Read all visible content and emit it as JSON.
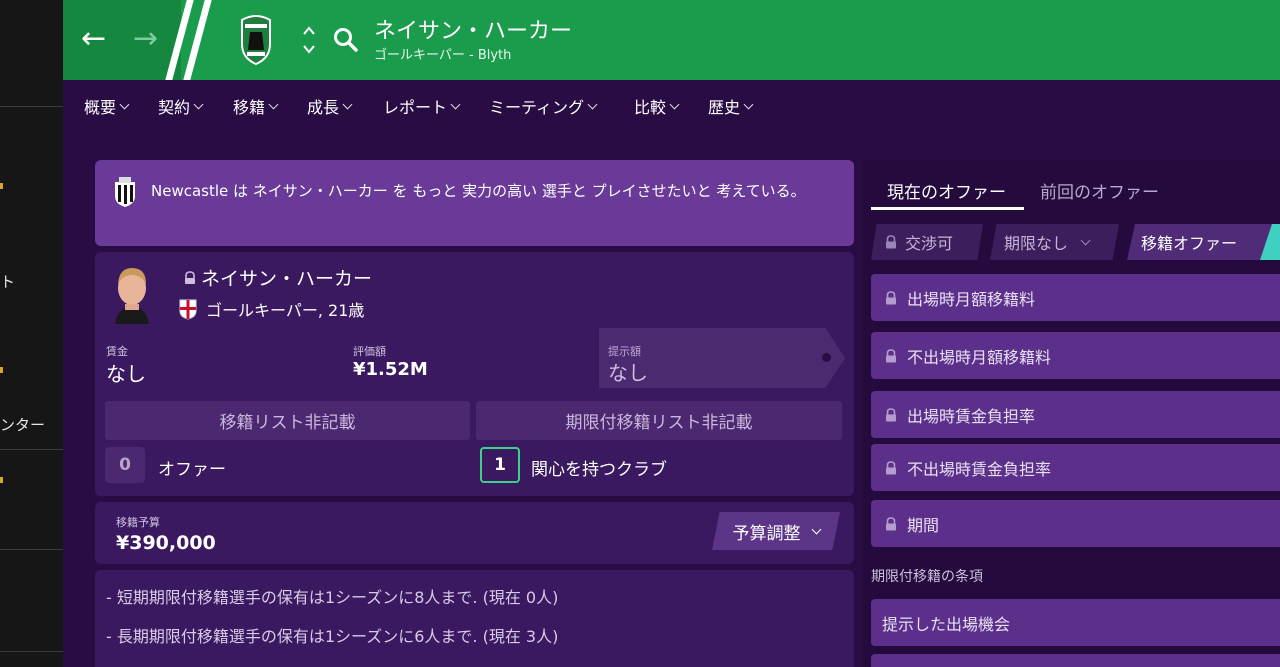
{
  "sidebar": {
    "fragments": [
      "ト",
      "ンター"
    ]
  },
  "header": {
    "player_name": "ネイサン・ハーカー",
    "subtitle": "ゴールキーパー - Blyth",
    "colors": {
      "header_bg": "#1b9c4d",
      "body_bg": "#2a0c45"
    }
  },
  "menu": [
    "概要",
    "契約",
    "移籍",
    "成長",
    "レポート",
    "ミーティング",
    "比較",
    "歴史"
  ],
  "notice": {
    "text": "Newcastle は ネイサン・ハーカー を もっと 実力の高い 選手と プレイさせたいと 考えている。"
  },
  "player_card": {
    "name": "ネイサン・ハーカー",
    "position_age": "ゴールキーパー, 21歳",
    "wage_label": "賃金",
    "wage_value": "なし",
    "value_label": "評価額",
    "value_value": "¥1.52M",
    "offer_label": "提示額",
    "offer_value": "なし",
    "transfer_list_button": "移籍リスト非記載",
    "loan_list_button": "期限付移籍リスト非記載",
    "offers_count": "0",
    "offers_label": "オファー",
    "interested_count": "1",
    "interested_label": "関心を持つクラブ"
  },
  "budget": {
    "label": "移籍予算",
    "value": "¥390,000",
    "adjust_button": "予算調整"
  },
  "rules": [
    "- 短期期限付移籍選手の保有は1シーズンに8人まで. (現在 0人)",
    "- 長期期限付移籍選手の保有は1シーズンに6人まで. (現在 3人)"
  ],
  "right_panel": {
    "tabs": [
      "現在のオファー",
      "前回のオファー"
    ],
    "negotiable": "交渉可",
    "no_deadline": "期限なし",
    "transfer_offer": "移籍オファー",
    "conditions": [
      "出場時月額移籍料",
      "不出場時月額移籍料",
      "出場時賃金負担率",
      "不出場時賃金負担率",
      "期間"
    ],
    "loan_terms_heading": "期限付移籍の条項",
    "loan_terms": [
      "提示した出場機会"
    ]
  }
}
